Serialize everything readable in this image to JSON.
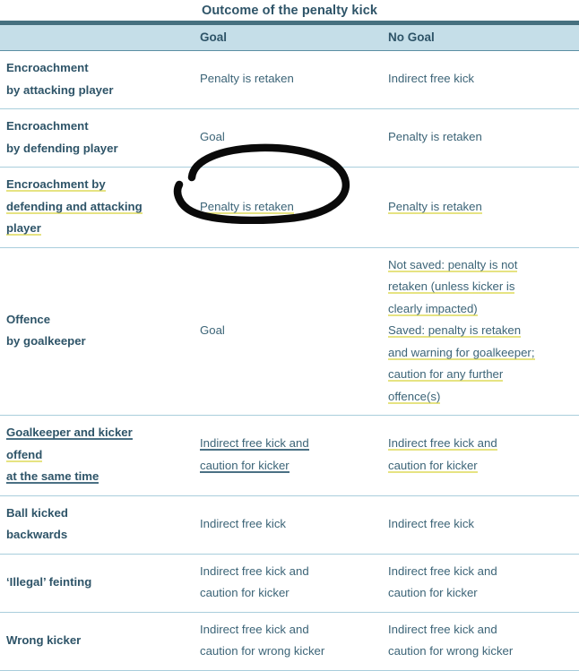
{
  "table": {
    "title": "Outcome of the penalty kick",
    "columns": [
      "",
      "Goal",
      "No Goal"
    ],
    "rows": [
      {
        "label": "Encroachment by attacking player",
        "label_lines": [
          "Encroachment",
          "by attacking player"
        ],
        "label_mark": "none",
        "goal": "Penalty is retaken",
        "goal_lines": [
          "Penalty is retaken"
        ],
        "goal_mark": "none",
        "no_goal": "Indirect free kick",
        "no_goal_lines": [
          "Indirect free kick"
        ],
        "no_goal_mark": "none"
      },
      {
        "label": "Encroachment by defending player",
        "label_lines": [
          "Encroachment",
          "by defending player"
        ],
        "label_mark": "none",
        "goal": "Goal",
        "goal_lines": [
          "Goal"
        ],
        "goal_mark": "none",
        "no_goal": "Penalty is retaken",
        "no_goal_lines": [
          "Penalty is retaken"
        ],
        "no_goal_mark": "none"
      },
      {
        "label": "Encroachment by defending and attacking player",
        "label_lines": [
          "Encroachment by ",
          "defending and attacking",
          "player"
        ],
        "label_mark": "highlight",
        "goal": "Penalty is retaken",
        "goal_lines": [
          "Penalty is retaken"
        ],
        "goal_mark": "highlight",
        "no_goal": "Penalty is retaken",
        "no_goal_lines": [
          "Penalty is retaken"
        ],
        "no_goal_mark": "highlight"
      },
      {
        "label": "Offence by goalkeeper",
        "label_lines": [
          "Offence",
          "by goalkeeper"
        ],
        "label_mark": "none",
        "goal": "Goal",
        "goal_lines": [
          "Goal"
        ],
        "goal_mark": "none",
        "no_goal": "Not saved: penalty is not retaken (unless kicker is clearly impacted) Saved: penalty is retaken and warning for goalkeeper; caution for any further offence(s)",
        "no_goal_lines": [
          "Not saved: penalty is not ",
          "retaken (unless kicker is ",
          "clearly impacted)",
          "Saved: penalty is retaken ",
          "and warning for goalkeeper;",
          "caution for any further ",
          "offence(s)"
        ],
        "no_goal_mark": "highlight"
      },
      {
        "label": "Goalkeeper and kicker offend at the same time",
        "label_lines": [
          "Goalkeeper and kicker",
          "offend ",
          "at the same time"
        ],
        "label_mark": "mixed",
        "goal": "Indirect free kick and caution for kicker",
        "goal_lines": [
          "Indirect free kick and ",
          "caution for kicker"
        ],
        "goal_mark": "underline",
        "no_goal": "Indirect free kick and caution for kicker",
        "no_goal_lines": [
          "Indirect free kick and ",
          "caution for kicker"
        ],
        "no_goal_mark": "highlight"
      },
      {
        "label": "Ball kicked backwards",
        "label_lines": [
          "Ball kicked",
          "backwards"
        ],
        "label_mark": "none",
        "goal": "Indirect free kick",
        "goal_lines": [
          "Indirect free kick"
        ],
        "goal_mark": "none",
        "no_goal": "Indirect free kick",
        "no_goal_lines": [
          "Indirect free kick"
        ],
        "no_goal_mark": "none"
      },
      {
        "label": "'Illegal' feinting",
        "label_lines": [
          "‘Illegal’ feinting"
        ],
        "label_mark": "none",
        "goal": "Indirect free kick and caution for kicker",
        "goal_lines": [
          "Indirect free kick and",
          "caution for kicker"
        ],
        "goal_mark": "none",
        "no_goal": "Indirect free kick and caution for kicker",
        "no_goal_lines": [
          "Indirect free kick and",
          "caution for kicker"
        ],
        "no_goal_mark": "none"
      },
      {
        "label": "Wrong kicker",
        "label_lines": [
          "Wrong kicker"
        ],
        "label_mark": "none",
        "goal": "Indirect free kick and caution for wrong kicker",
        "goal_lines": [
          "Indirect free kick and",
          "caution for wrong kicker"
        ],
        "goal_mark": "none",
        "no_goal": "Indirect free kick and caution for wrong kicker",
        "no_goal_lines": [
          "Indirect free kick and",
          "caution for wrong kicker"
        ],
        "no_goal_mark": "none"
      }
    ]
  },
  "annotation": {
    "type": "hand-drawn-ellipse",
    "color": "#000000",
    "encircles": "Penalty is retaken"
  },
  "colors": {
    "header_bar": "#46707F",
    "header_row": "#C5DEE8",
    "text": "#2E5468",
    "body_text": "#3C6477",
    "row_divider": "#A9CEDC",
    "highlight_yellow": "#E6E382",
    "underline_dark": "#4A7084"
  }
}
